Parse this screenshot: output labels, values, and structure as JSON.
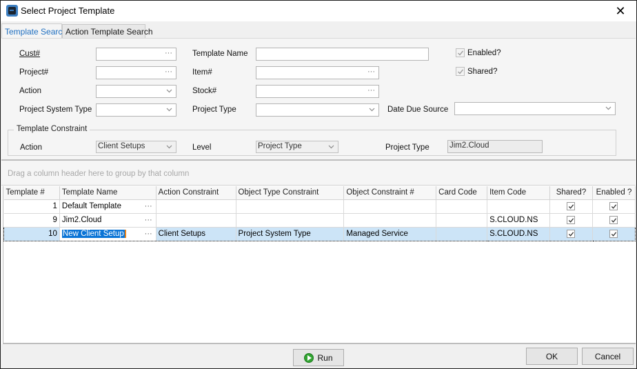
{
  "window": {
    "title": "Select Project Template",
    "close_label": "✕"
  },
  "tabs": [
    {
      "label": "Template Search",
      "active": true
    },
    {
      "label": "Action Template Search",
      "active": false
    }
  ],
  "search": {
    "cust_label": "Cust#",
    "cust_value": "",
    "project_label": "Project#",
    "project_value": "",
    "action_label": "Action",
    "action_value": "",
    "project_system_type_label": "Project System Type",
    "project_system_type_value": "",
    "template_name_label": "Template Name",
    "template_name_value": "",
    "item_label": "Item#",
    "item_value": "",
    "stock_label": "Stock#",
    "stock_value": "",
    "project_type_label": "Project Type",
    "project_type_value": "",
    "date_due_source_label": "Date Due Source",
    "date_due_source_value": "",
    "enabled_label": "Enabled?",
    "enabled_checked": true,
    "shared_label": "Shared?",
    "shared_checked": true,
    "ellipsis": "···"
  },
  "constraint": {
    "group_title": "Template Constraint",
    "action_label": "Action",
    "action_value": "Client Setups",
    "level_label": "Level",
    "level_value": "Project Type",
    "project_type_label": "Project Type",
    "project_type_value": "Jim2.Cloud"
  },
  "grid": {
    "group_hint": "Drag a column header here to group by that column",
    "columns": [
      "Template #",
      "Template Name",
      "Action Constraint",
      "Object Type Constraint",
      "Object Constraint #",
      "Card Code",
      "Item Code",
      "Shared?",
      "Enabled ?"
    ],
    "rows": [
      {
        "template_no": "1",
        "template_name": "Default Template",
        "action_constraint": "",
        "object_type_constraint": "",
        "object_constraint_no": "",
        "card_code": "",
        "item_code": "",
        "shared": true,
        "enabled": true,
        "selected": false
      },
      {
        "template_no": "9",
        "template_name": "Jim2.Cloud",
        "action_constraint": "",
        "object_type_constraint": "",
        "object_constraint_no": "",
        "card_code": "",
        "item_code": "S.CLOUD.NS",
        "shared": true,
        "enabled": true,
        "selected": false
      },
      {
        "template_no": "10",
        "template_name": "New Client Setup",
        "action_constraint": "Client Setups",
        "object_type_constraint": "Project System Type",
        "object_constraint_no": "Managed Service",
        "card_code": "",
        "item_code": "S.CLOUD.NS",
        "shared": true,
        "enabled": true,
        "selected": true
      }
    ],
    "cell_ellipsis": "···"
  },
  "footer": {
    "run_label": "Run",
    "ok_label": "OK",
    "cancel_label": "Cancel"
  }
}
